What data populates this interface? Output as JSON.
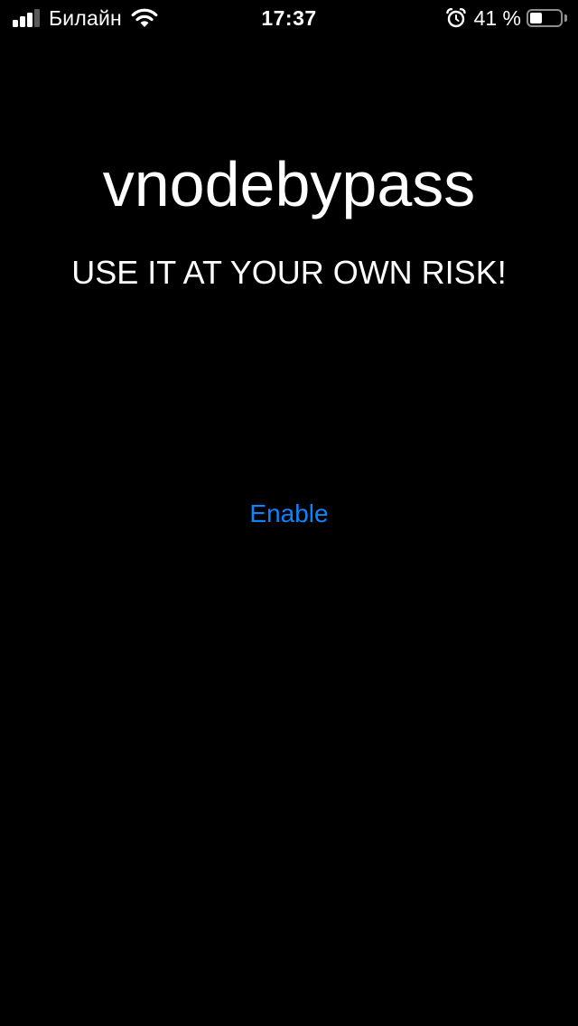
{
  "status_bar": {
    "carrier": "Билайн",
    "time": "17:37",
    "battery_percent": "41 %",
    "battery_level": 0.41,
    "signal_bars": 4,
    "signal_active_bars": 3,
    "icons": {
      "signal": "cellular-signal-icon",
      "wifi": "wifi-icon",
      "alarm": "alarm-clock-icon",
      "battery": "battery-icon"
    }
  },
  "main": {
    "title": "vnodebypass",
    "warning": "USE IT AT YOUR OWN RISK!",
    "enable_label": "Enable"
  },
  "colors": {
    "background": "#000000",
    "text": "#ffffff",
    "accent": "#0a84ff"
  }
}
